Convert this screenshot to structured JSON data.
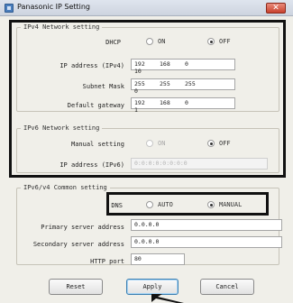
{
  "window": {
    "title": "Panasonic IP Setting",
    "close_label": "✕"
  },
  "ipv4": {
    "section_title": "IPv4 Network setting",
    "dhcp": {
      "label": "DHCP",
      "on": "ON",
      "off": "OFF",
      "selected": "off"
    },
    "ip_address": {
      "label": "IP address (IPv4)",
      "octets": [
        "192",
        "168",
        "0",
        "10"
      ]
    },
    "subnet_mask": {
      "label": "Subnet Mask",
      "octets": [
        "255",
        "255",
        "255",
        "0"
      ]
    },
    "default_gateway": {
      "label": "Default gateway",
      "octets": [
        "192",
        "168",
        "0",
        "1"
      ]
    }
  },
  "ipv6": {
    "section_title": "IPv6 Network setting",
    "manual": {
      "label": "Manual setting",
      "on": "ON",
      "off": "OFF",
      "selected": "off"
    },
    "ip_address": {
      "label": "IP address (IPv6)",
      "value": "0:0:0:0:0:0:0:0"
    }
  },
  "common": {
    "section_title": "IPv6/v4 Common setting",
    "dns": {
      "label": "DNS",
      "auto": "AUTO",
      "manual": "MANUAL",
      "selected": "manual"
    },
    "primary_server": {
      "label": "Primary server address",
      "value": "0.0.0.0"
    },
    "secondary_server": {
      "label": "Secondary server address",
      "value": "0.0.0.0"
    },
    "http_port": {
      "label": "HTTP port",
      "value": "80"
    }
  },
  "buttons": {
    "reset": "Reset",
    "apply": "Apply",
    "cancel": "Cancel"
  },
  "colors": {
    "highlight_border": "#111111",
    "dialog_background": "#f0efe9",
    "close_button": "#c9412d"
  }
}
